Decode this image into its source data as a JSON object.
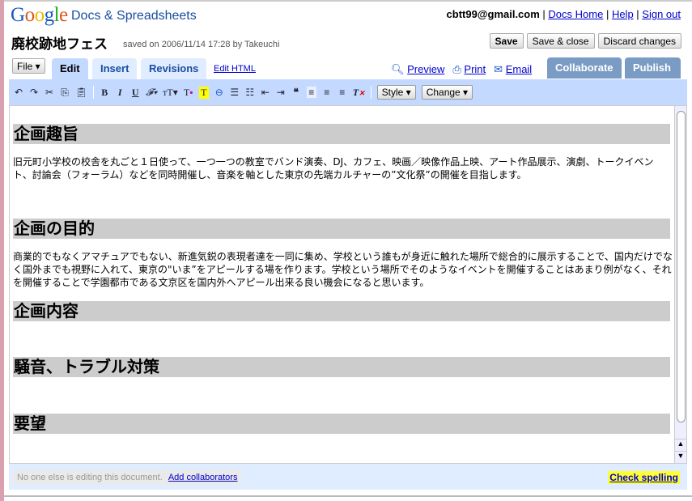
{
  "header": {
    "logo": "Google",
    "product": "Docs & Spreadsheets",
    "email": "cbtt99@gmail.com",
    "links": [
      "Docs Home",
      "Help",
      "Sign out"
    ]
  },
  "doc": {
    "title": "廃校跡地フェス",
    "saved": "saved on 2006/11/14 17:28 by Takeuchi"
  },
  "buttons": {
    "save": "Save",
    "save_close": "Save & close",
    "discard": "Discard changes"
  },
  "tabs": {
    "file": "File ▾",
    "edit": "Edit",
    "insert": "Insert",
    "revisions": "Revisions",
    "edit_html": "Edit HTML",
    "collaborate": "Collaborate",
    "publish": "Publish"
  },
  "actions": {
    "preview": "Preview",
    "print": "Print",
    "email": "Email"
  },
  "toolbar": {
    "bold": "B",
    "italic": "I",
    "underline": "U",
    "style": "Style ▾",
    "change": "Change ▾"
  },
  "content": {
    "h1": "企画趣旨",
    "p1": "旧元町小学校の校舎を丸ごと１日使って、一つ一つの教室でバンド演奏、DJ、カフェ、映画／映像作品上映、アート作品展示、演劇、トークイベント、討論会（フォーラム）などを同時開催し、音楽を軸とした東京の先端カルチャーの”文化祭”の開催を目指します。",
    "h2": "企画の目的",
    "p2": "商業的でもなくアマチュアでもない、新進気鋭の表現者達を一同に集め、学校という誰もが身近に触れた場所で総合的に展示することで、国内だけでなく国外までも視野に入れて、東京の\"いま”をアピールする場を作ります。学校という場所でそのようなイベントを開催することはあまり例がなく、それを開催することで学園都市である文京区を国内外へアピール出来る良い機会になると思います。",
    "h3": "企画内容",
    "h4": "騒音、トラブル対策",
    "h5": "要望"
  },
  "footer": {
    "status": "No one else is editing this document.",
    "add": "Add collaborators",
    "spell": "Check spelling"
  }
}
